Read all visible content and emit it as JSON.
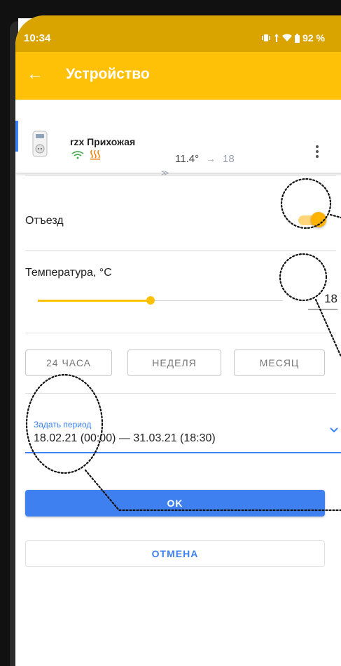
{
  "status_bar": {
    "time": "10:34",
    "battery": "92 %",
    "icons": [
      "vibrate-icon",
      "wifi-icon",
      "battery-icon"
    ]
  },
  "app_bar": {
    "title": "Устройство",
    "back_icon": "arrow-left-icon"
  },
  "device": {
    "name": "rzx Прихожая",
    "current_temp": "11.4°",
    "arrow": "→",
    "target_temp": "18",
    "icons": [
      "socket-thermostat-icon",
      "wifi-icon",
      "heating-icon",
      "more-vert-icon",
      "expand-more-icon"
    ]
  },
  "away": {
    "label": "Отъезд",
    "enabled": true
  },
  "temperature": {
    "label": "Температура, °C",
    "value": "18",
    "slider_fraction": 0.46
  },
  "periods": [
    {
      "label": "24 ЧАСА"
    },
    {
      "label": "НЕДЕЛЯ"
    },
    {
      "label": "МЕСЯЦ"
    }
  ],
  "period_field": {
    "label": "Задать период",
    "value": "18.02.21 (00:00) — 31.03.21 (18:30)"
  },
  "actions": {
    "ok": "OK",
    "cancel": "ОТМЕНА"
  },
  "colors": {
    "accent": "#ffc107",
    "status": "#d9a400",
    "primary": "#3f80f0"
  }
}
